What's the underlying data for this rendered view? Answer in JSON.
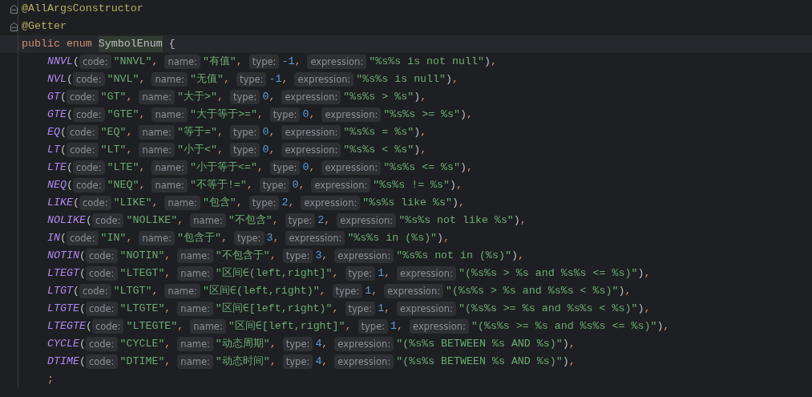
{
  "annotations": [
    {
      "text": "@AllArgsConstructor",
      "folded": false
    },
    {
      "text": "@Getter",
      "folded": false
    }
  ],
  "declaration": {
    "keywords": [
      "public",
      "enum"
    ],
    "name": "SymbolEnum",
    "brace": "{",
    "current_line": true
  },
  "constants": [
    {
      "name": "NNVL",
      "open": "(",
      "args": [
        {
          "hint": "code:",
          "value": "\"NNVL\"",
          "kind": "string",
          "sep": ","
        },
        {
          "hint": "name:",
          "value": "\"有值\"",
          "kind": "string",
          "sep": ","
        },
        {
          "hint": "type:",
          "value": "-1",
          "kind": "number",
          "sep": ","
        },
        {
          "hint": "expression:",
          "value": "\"%s%s is not null\"",
          "kind": "string"
        }
      ],
      "close": ")",
      "end": ","
    },
    {
      "name": "NVL",
      "open": "(",
      "args": [
        {
          "hint": "code:",
          "value": "\"NVL\"",
          "kind": "string",
          "sep": ","
        },
        {
          "hint": "name:",
          "value": "\"无值\"",
          "kind": "string",
          "sep": ","
        },
        {
          "hint": "type:",
          "value": "-1",
          "kind": "number",
          "sep": ","
        },
        {
          "hint": "expression:",
          "value": "\"%s%s is null\"",
          "kind": "string"
        }
      ],
      "close": ")",
      "end": ","
    },
    {
      "name": "GT",
      "open": "(",
      "args": [
        {
          "hint": "code:",
          "value": "\"GT\"",
          "kind": "string",
          "sep": ","
        },
        {
          "hint": "name:",
          "value": "\"大于>\"",
          "kind": "string",
          "sep": ","
        },
        {
          "hint": "type:",
          "value": "0",
          "kind": "number",
          "sep": ","
        },
        {
          "hint": "expression:",
          "value": "\"%s%s > %s\"",
          "kind": "string"
        }
      ],
      "close": ")",
      "end": ","
    },
    {
      "name": "GTE",
      "open": "(",
      "args": [
        {
          "hint": "code:",
          "value": "\"GTE\"",
          "kind": "string",
          "sep": ","
        },
        {
          "hint": "name:",
          "value": "\"大于等于>=\"",
          "kind": "string",
          "sep": ","
        },
        {
          "hint": "type:",
          "value": "0",
          "kind": "number",
          "sep": ","
        },
        {
          "hint": "expression:",
          "value": "\"%s%s >= %s\"",
          "kind": "string"
        }
      ],
      "close": ")",
      "end": ","
    },
    {
      "name": "EQ",
      "open": "(",
      "args": [
        {
          "hint": "code:",
          "value": "\"EQ\"",
          "kind": "string",
          "sep": ","
        },
        {
          "hint": "name:",
          "value": "\"等于=\"",
          "kind": "string",
          "sep": ","
        },
        {
          "hint": "type:",
          "value": "0",
          "kind": "number",
          "sep": ","
        },
        {
          "hint": "expression:",
          "value": "\"%s%s = %s\"",
          "kind": "string"
        }
      ],
      "close": ")",
      "end": ","
    },
    {
      "name": "LT",
      "open": "(",
      "args": [
        {
          "hint": "code:",
          "value": "\"LT\"",
          "kind": "string",
          "sep": ","
        },
        {
          "hint": "name:",
          "value": "\"小于<\"",
          "kind": "string",
          "sep": ","
        },
        {
          "hint": "type:",
          "value": "0",
          "kind": "number",
          "sep": ","
        },
        {
          "hint": "expression:",
          "value": "\"%s%s < %s\"",
          "kind": "string"
        }
      ],
      "close": ")",
      "end": ","
    },
    {
      "name": "LTE",
      "open": "(",
      "args": [
        {
          "hint": "code:",
          "value": "\"LTE\"",
          "kind": "string",
          "sep": ","
        },
        {
          "hint": "name:",
          "value": "\"小于等于<=\"",
          "kind": "string",
          "sep": ","
        },
        {
          "hint": "type:",
          "value": "0",
          "kind": "number",
          "sep": ","
        },
        {
          "hint": "expression:",
          "value": "\"%s%s <= %s\"",
          "kind": "string"
        }
      ],
      "close": ")",
      "end": ","
    },
    {
      "name": "NEQ",
      "open": "(",
      "args": [
        {
          "hint": "code:",
          "value": "\"NEQ\"",
          "kind": "string",
          "sep": ","
        },
        {
          "hint": "name:",
          "value": "\"不等于!=\"",
          "kind": "string",
          "sep": ","
        },
        {
          "hint": "type:",
          "value": "0",
          "kind": "number",
          "sep": ","
        },
        {
          "hint": "expression:",
          "value": "\"%s%s != %s\"",
          "kind": "string"
        }
      ],
      "close": ")",
      "end": ","
    },
    {
      "name": "LIKE",
      "open": "(",
      "args": [
        {
          "hint": "code:",
          "value": "\"LIKE\"",
          "kind": "string",
          "sep": ","
        },
        {
          "hint": "name:",
          "value": "\"包含\"",
          "kind": "string",
          "sep": ","
        },
        {
          "hint": "type:",
          "value": "2",
          "kind": "number",
          "sep": ","
        },
        {
          "hint": "expression:",
          "value": "\"%s%s like %s\"",
          "kind": "string"
        }
      ],
      "close": ")",
      "end": ","
    },
    {
      "name": "NOLIKE",
      "open": "(",
      "args": [
        {
          "hint": "code:",
          "value": "\"NOLIKE\"",
          "kind": "string",
          "sep": ","
        },
        {
          "hint": "name:",
          "value": "\"不包含\"",
          "kind": "string",
          "sep": ","
        },
        {
          "hint": "type:",
          "value": "2",
          "kind": "number",
          "sep": ","
        },
        {
          "hint": "expression:",
          "value": "\"%s%s not like %s\"",
          "kind": "string"
        }
      ],
      "close": ")",
      "end": ","
    },
    {
      "name": "IN",
      "open": "(",
      "args": [
        {
          "hint": "code:",
          "value": "\"IN\"",
          "kind": "string",
          "sep": ","
        },
        {
          "hint": "name:",
          "value": "\"包含于\"",
          "kind": "string",
          "sep": ","
        },
        {
          "hint": "type:",
          "value": "3",
          "kind": "number",
          "sep": ","
        },
        {
          "hint": "expression:",
          "value": "\"%s%s in (%s)\"",
          "kind": "string"
        }
      ],
      "close": ")",
      "end": ","
    },
    {
      "name": "NOTIN",
      "open": "(",
      "args": [
        {
          "hint": "code:",
          "value": "\"NOTIN\"",
          "kind": "string",
          "sep": ","
        },
        {
          "hint": "name:",
          "value": "\"不包含于\"",
          "kind": "string",
          "sep": ","
        },
        {
          "hint": "type:",
          "value": "3",
          "kind": "number",
          "sep": ","
        },
        {
          "hint": "expression:",
          "value": "\"%s%s not in (%s)\"",
          "kind": "string"
        }
      ],
      "close": ")",
      "end": ","
    },
    {
      "name": "LTEGT",
      "open": "(",
      "args": [
        {
          "hint": "code:",
          "value": "\"LTEGT\"",
          "kind": "string",
          "sep": ","
        },
        {
          "hint": "name:",
          "value": "\"区间∈(left,right]\"",
          "kind": "string",
          "sep": ","
        },
        {
          "hint": "type:",
          "value": "1",
          "kind": "number",
          "sep": ","
        },
        {
          "hint": "expression:",
          "value": "\"(%s%s > %s and %s%s <= %s)\"",
          "kind": "string"
        }
      ],
      "close": ")",
      "end": ","
    },
    {
      "name": "LTGT",
      "open": "(",
      "args": [
        {
          "hint": "code:",
          "value": "\"LTGT\"",
          "kind": "string",
          "sep": ","
        },
        {
          "hint": "name:",
          "value": "\"区间∈(left,right)\"",
          "kind": "string",
          "sep": ","
        },
        {
          "hint": "type:",
          "value": "1",
          "kind": "number",
          "sep": ","
        },
        {
          "hint": "expression:",
          "value": "\"(%s%s > %s and %s%s < %s)\"",
          "kind": "string"
        }
      ],
      "close": ")",
      "end": ","
    },
    {
      "name": "LTGTE",
      "open": "(",
      "args": [
        {
          "hint": "code:",
          "value": "\"LTGTE\"",
          "kind": "string",
          "sep": ","
        },
        {
          "hint": "name:",
          "value": "\"区间∈[left,right)\"",
          "kind": "string",
          "sep": ","
        },
        {
          "hint": "type:",
          "value": "1",
          "kind": "number",
          "sep": ","
        },
        {
          "hint": "expression:",
          "value": "\"(%s%s >= %s and %s%s < %s)\"",
          "kind": "string"
        }
      ],
      "close": ")",
      "end": ","
    },
    {
      "name": "LTEGTE",
      "open": "(",
      "args": [
        {
          "hint": "code:",
          "value": "\"LTEGTE\"",
          "kind": "string",
          "sep": ","
        },
        {
          "hint": "name:",
          "value": "\"区间∈[left,right]\"",
          "kind": "string",
          "sep": ","
        },
        {
          "hint": "type:",
          "value": "1",
          "kind": "number",
          "sep": ","
        },
        {
          "hint": "expression:",
          "value": "\"(%s%s >= %s and %s%s <= %s)\"",
          "kind": "string"
        }
      ],
      "close": ")",
      "end": ","
    },
    {
      "name": "CYCLE",
      "open": "(",
      "args": [
        {
          "hint": "code:",
          "value": "\"CYCLE\"",
          "kind": "string",
          "sep": ","
        },
        {
          "hint": "name:",
          "value": "\"动态周期\"",
          "kind": "string",
          "sep": ","
        },
        {
          "hint": "type:",
          "value": "4",
          "kind": "number",
          "sep": ","
        },
        {
          "hint": "expression:",
          "value": "\"(%s%s BETWEEN %s AND %s)\"",
          "kind": "string"
        }
      ],
      "close": ")",
      "end": ","
    },
    {
      "name": "DTIME",
      "open": "(",
      "args": [
        {
          "hint": "code:",
          "value": "\"DTIME\"",
          "kind": "string",
          "sep": ","
        },
        {
          "hint": "name:",
          "value": "\"动态时间\"",
          "kind": "string",
          "sep": ","
        },
        {
          "hint": "type:",
          "value": "4",
          "kind": "number",
          "sep": ","
        },
        {
          "hint": "expression:",
          "value": "\"(%s%s BETWEEN %s AND %s)\"",
          "kind": "string"
        }
      ],
      "close": ")",
      "end": ","
    }
  ],
  "terminator": ";"
}
